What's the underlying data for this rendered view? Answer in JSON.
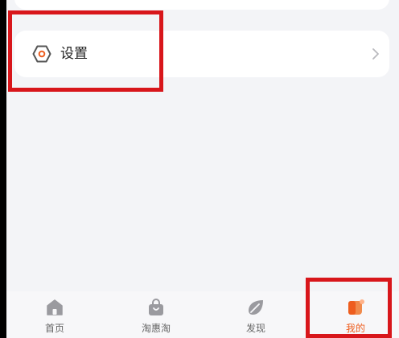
{
  "settings": {
    "label": "设置"
  },
  "tabbar": {
    "items": [
      {
        "label": "首页",
        "icon": "home-icon",
        "active": false
      },
      {
        "label": "淘惠淘",
        "icon": "shopping-bag-icon",
        "active": false
      },
      {
        "label": "发现",
        "icon": "leaf-icon",
        "active": false
      },
      {
        "label": "我的",
        "icon": "profile-icon",
        "active": true
      }
    ]
  },
  "colors": {
    "accent": "#ee5d1e",
    "highlight": "#d8161b",
    "background": "#f3f4f7",
    "icon_gray": "#9a9a9f"
  }
}
